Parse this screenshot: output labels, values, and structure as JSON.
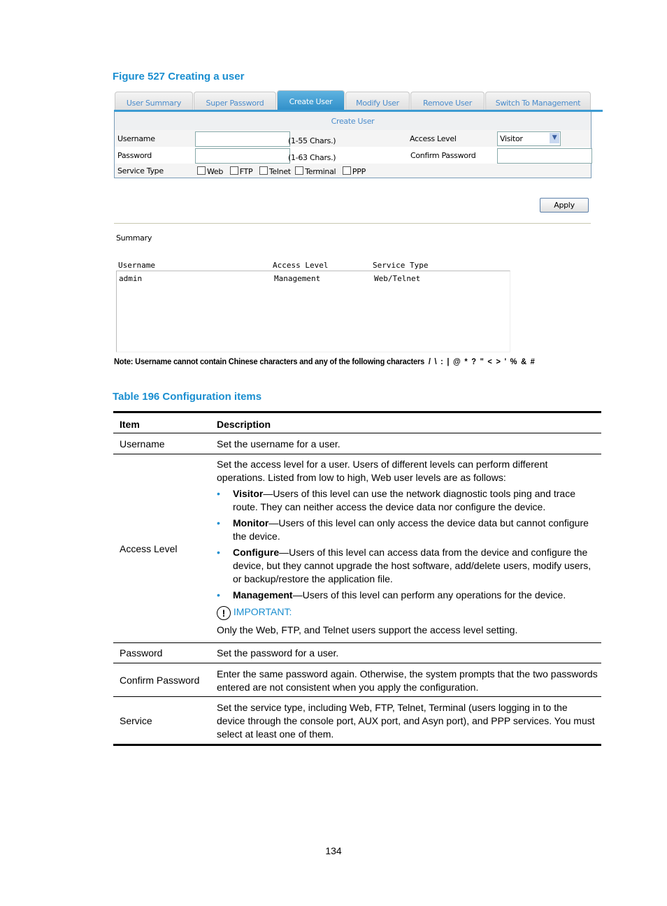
{
  "figure_caption": "Figure 527 Creating a user",
  "tabs": [
    "User Summary",
    "Super Password",
    "Create User",
    "Modify User",
    "Remove User",
    "Switch To Management"
  ],
  "form": {
    "title": "Create User",
    "username_label": "Username",
    "username_value": "",
    "username_hint": "(1-55 Chars.)",
    "password_label": "Password",
    "password_value": "",
    "password_hint": "(1-63 Chars.)",
    "access_level_label": "Access Level",
    "access_level_value": "Visitor",
    "confirm_password_label": "Confirm Password",
    "confirm_password_value": "",
    "service_type_label": "Service Type",
    "services": [
      "Web",
      "FTP",
      "Telnet",
      "Terminal",
      "PPP"
    ],
    "apply_label": "Apply"
  },
  "summary": {
    "title": "Summary",
    "columns": [
      "Username",
      "Access Level",
      "Service Type"
    ],
    "rows": [
      [
        "admin",
        "Management",
        "Web/Telnet"
      ]
    ]
  },
  "note": "Note: Username cannot contain Chinese characters and any of the following characters  /  \\  :  |  @  *  ?  \"  <  >  '  %  &  #",
  "table_caption": "Table 196 Configuration items",
  "table": {
    "headers": [
      "Item",
      "Description"
    ],
    "username": {
      "item": "Username",
      "desc": "Set the username for a user."
    },
    "access": {
      "item": "Access Level",
      "intro": "Set the access level for a user. Users of different levels can perform different operations. Listed from low to high, Web user levels are as follows:",
      "bullets": [
        {
          "term": "Visitor",
          "text": "—Users of this level can use the network diagnostic tools ping and trace route. They can neither access the device data nor configure the device."
        },
        {
          "term": "Monitor",
          "text": "—Users of this level can only access the device data but cannot configure the device."
        },
        {
          "term": "Configure",
          "text": "—Users of this level can access data from the device and configure the device, but they cannot upgrade the host software, add/delete users, modify users, or backup/restore the application file."
        },
        {
          "term": "Management",
          "text": "—Users of this level can perform any operations for the device."
        }
      ],
      "important_label": "IMPORTANT:",
      "important_text": "Only the Web, FTP, and Telnet users support the access level setting."
    },
    "password": {
      "item": "Password",
      "desc": "Set the password for a user."
    },
    "confirm": {
      "item": "Confirm Password",
      "desc": "Enter the same password again. Otherwise, the system prompts that the two passwords entered are not consistent when you apply the configuration."
    },
    "service": {
      "item": "Service",
      "desc": "Set the service type, including Web, FTP, Telnet, Terminal (users logging in to the device through the console port, AUX port, and Asyn port), and PPP services. You must select at least one of them."
    }
  },
  "page_number": "134",
  "colors": {
    "accent": "#1a8ed0"
  }
}
